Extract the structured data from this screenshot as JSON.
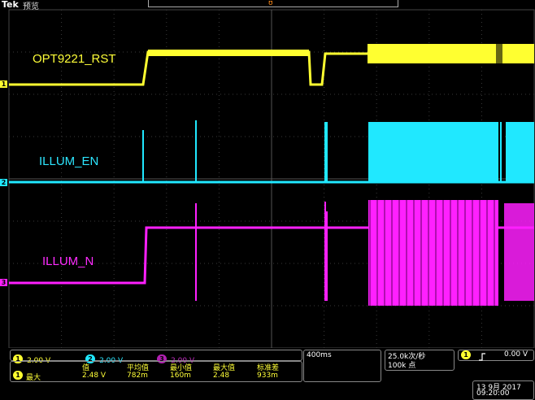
{
  "header": {
    "brand": "Tek",
    "mode": "预览"
  },
  "channels": {
    "ch1": {
      "number": "1",
      "name": "OPT9221_RST",
      "color": "#ffff30",
      "scale": "2.00 V"
    },
    "ch2": {
      "number": "2",
      "name": "ILLUM_EN",
      "color": "#20e8ff",
      "scale": "2.00 V"
    },
    "ch3": {
      "number": "3",
      "name": "ILLUM_N",
      "color": "#ff20ff",
      "scale": "2.00 V"
    }
  },
  "measurement": {
    "source": "1",
    "type": "最大",
    "headers": [
      "值",
      "平均值",
      "最小值",
      "最大值",
      "标准差"
    ],
    "values": [
      "2.48 V",
      "782m",
      "160m",
      "2.48",
      "933m"
    ]
  },
  "horizontal": {
    "timebase": "400ms",
    "sample_rate": "25.0k次/秒",
    "record_length": "100k 点"
  },
  "trigger": {
    "source": "1",
    "slope_icon": "rising-edge-icon",
    "level": "0.00 V"
  },
  "datetime": {
    "date": "13 9月 2017",
    "time": "09:20:00"
  }
}
